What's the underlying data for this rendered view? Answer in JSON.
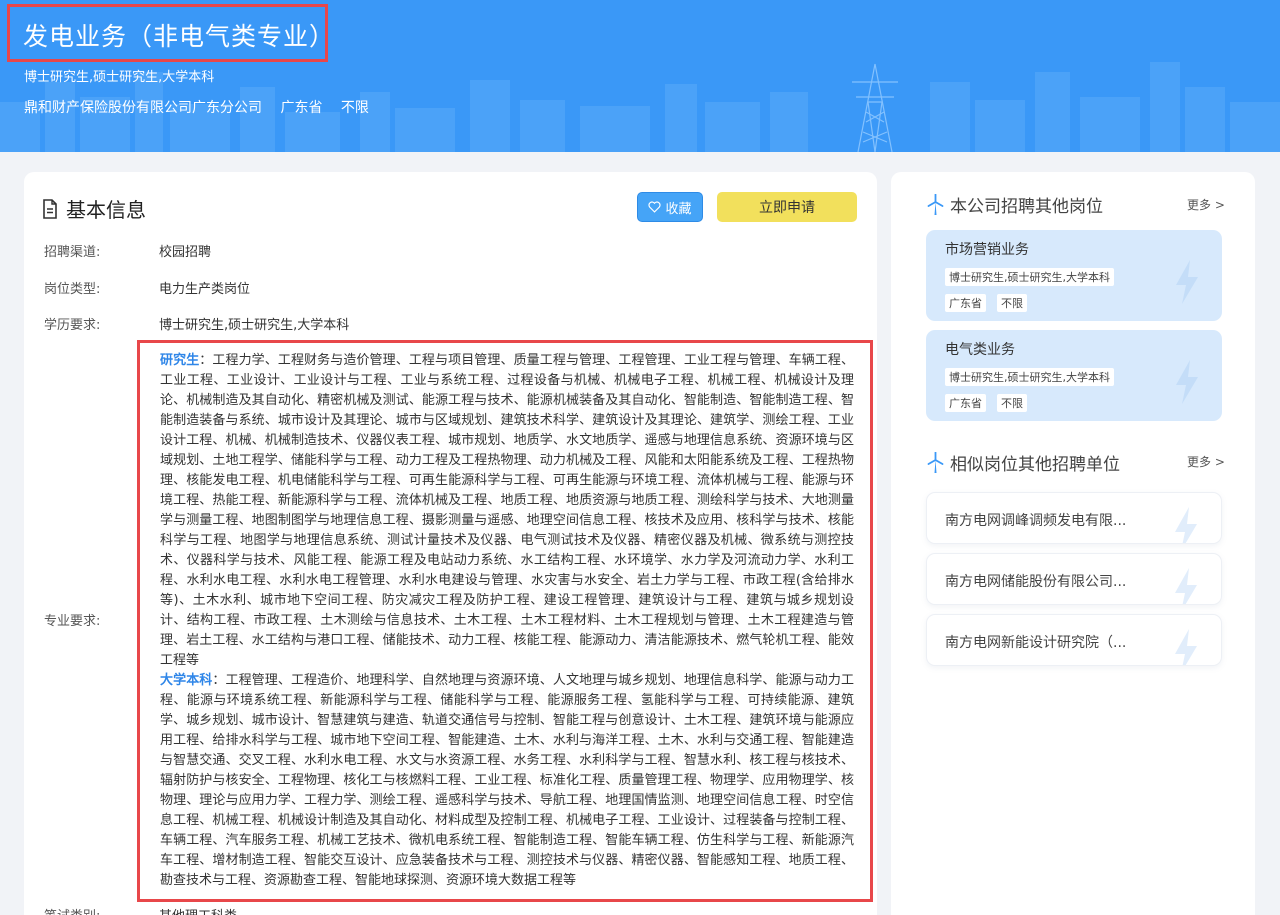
{
  "hero": {
    "title": "发电业务（非电气类专业）",
    "education": "博士研究生,硕士研究生,大学本科",
    "company": "鼎和财产保险股份有限公司广东分公司",
    "province": "广东省",
    "limit": "不限"
  },
  "actions": {
    "favorite_label": "收藏",
    "apply_label": "立即申请"
  },
  "basic_info": {
    "title": "基本信息",
    "channel_label": "招聘渠道:",
    "channel_value": "校园招聘",
    "type_label": "岗位类型:",
    "type_value": "电力生产类岗位",
    "education_label": "学历要求:",
    "education_value": "博士研究生,硕士研究生,大学本科",
    "major_label": "专业要求:",
    "exam_label": "笔试类别:",
    "exam_value": "其他理工科类"
  },
  "majors": {
    "graduate_tag": "研究生",
    "graduate_text": "：工程力学、工程财务与造价管理、工程与项目管理、质量工程与管理、工程管理、工业工程与管理、车辆工程、工业工程、工业设计、工业设计与工程、工业与系统工程、过程设备与机械、机械电子工程、机械工程、机械设计及理论、机械制造及其自动化、精密机械及测试、能源工程与技术、能源机械装备及其自动化、智能制造、智能制造工程、智能制造装备与系统、城市设计及其理论、城市与区域规划、建筑技术科学、建筑设计及其理论、建筑学、测绘工程、工业设计工程、机械、机械制造技术、仪器仪表工程、城市规划、地质学、水文地质学、遥感与地理信息系统、资源环境与区域规划、土地工程学、储能科学与工程、动力工程及工程热物理、动力机械及工程、风能和太阳能系统及工程、工程热物理、核能发电工程、机电储能科学与工程、可再生能源科学与工程、可再生能源与环境工程、流体机械与工程、能源与环境工程、热能工程、新能源科学与工程、流体机械及工程、地质工程、地质资源与地质工程、测绘科学与技术、大地测量学与测量工程、地图制图学与地理信息工程、摄影测量与遥感、地理空间信息工程、核技术及应用、核科学与技术、核能科学与工程、地图学与地理信息系统、测试计量技术及仪器、电气测试技术及仪器、精密仪器及机械、微系统与测控技术、仪器科学与技术、风能工程、能源工程及电站动力系统、水工结构工程、水环境学、水力学及河流动力学、水利工程、水利水电工程、水利水电工程管理、水利水电建设与管理、水灾害与水安全、岩土力学与工程、市政工程(含给排水等)、土木水利、城市地下空间工程、防灾减灾工程及防护工程、建设工程管理、建筑设计与工程、建筑与城乡规划设计、结构工程、市政工程、土木测绘与信息技术、土木工程、土木工程材料、土木工程规划与管理、土木工程建造与管理、岩土工程、水工结构与港口工程、储能技术、动力工程、核能工程、能源动力、清洁能源技术、燃气轮机工程、能效工程等",
    "undergrad_tag": "大学本科",
    "undergrad_text": "：工程管理、工程造价、地理科学、自然地理与资源环境、人文地理与城乡规划、地理信息科学、能源与动力工程、能源与环境系统工程、新能源科学与工程、储能科学与工程、能源服务工程、氢能科学与工程、可持续能源、建筑学、城乡规划、城市设计、智慧建筑与建造、轨道交通信号与控制、智能工程与创意设计、土木工程、建筑环境与能源应用工程、给排水科学与工程、城市地下空间工程、智能建造、土木、水利与海洋工程、土木、水利与交通工程、智能建造与智慧交通、交叉工程、水利水电工程、水文与水资源工程、水务工程、水利科学与工程、智慧水利、核工程与核技术、辐射防护与核安全、工程物理、核化工与核燃料工程、工业工程、标准化工程、质量管理工程、物理学、应用物理学、核物理、理论与应用力学、工程力学、测绘工程、遥感科学与技术、导航工程、地理国情监测、地理空间信息工程、时空信息工程、机械工程、机械设计制造及其自动化、材料成型及控制工程、机械电子工程、工业设计、过程装备与控制工程、车辆工程、汽车服务工程、机械工艺技术、微机电系统工程、智能制造工程、智能车辆工程、仿生科学与工程、新能源汽车工程、增材制造工程、智能交互设计、应急装备技术与工程、测控技术与仪器、精密仪器、智能感知工程、地质工程、勘查技术与工程、资源勘查工程、智能地球探测、资源环境大数据工程等"
  },
  "sidebar": {
    "company_jobs_title": "本公司招聘其他岗位",
    "more_label": "更多 >",
    "jobs": [
      {
        "title": "市场营销业务",
        "education": "博士研究生,硕士研究生,大学本科",
        "province": "广东省",
        "limit": "不限"
      },
      {
        "title": "电气类业务",
        "education": "博士研究生,硕士研究生,大学本科",
        "province": "广东省",
        "limit": "不限"
      }
    ],
    "similar_title": "相似岗位其他招聘单位",
    "companies": [
      {
        "name": "南方电网调峰调频发电有限..."
      },
      {
        "name": "南方电网储能股份有限公司..."
      },
      {
        "name": "南方电网新能设计研究院（..."
      }
    ]
  },
  "colors": {
    "hero_bg": "#3a98f7",
    "accent_blue": "#2f86e8",
    "apply_yellow": "#f2e05c",
    "highlight_red": "#e8474a",
    "job_card_bg": "#d7e9fc"
  }
}
